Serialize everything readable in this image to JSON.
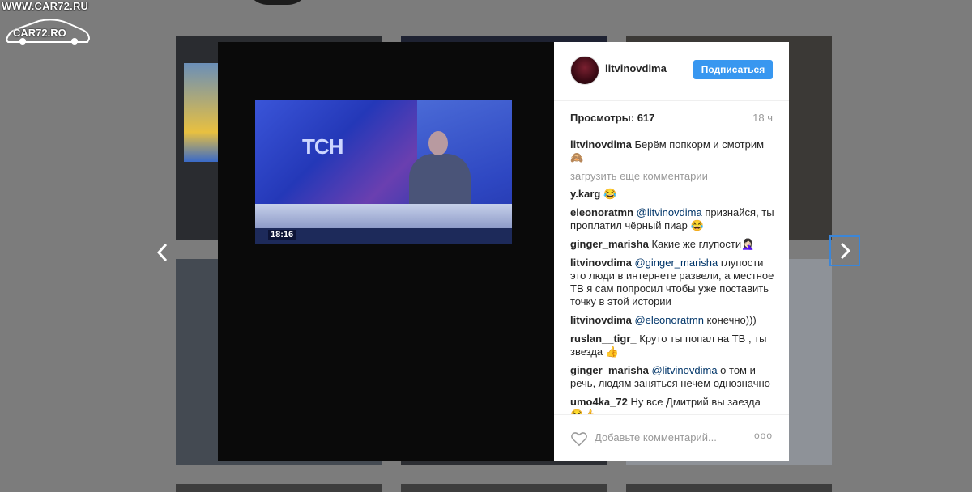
{
  "watermark": {
    "url": "WWW.CAR72.RU",
    "logo_text": "CAR72.RO"
  },
  "video": {
    "time": "18:16",
    "channel": "ТСН"
  },
  "post": {
    "username": "litvinovdima",
    "follow_label": "Подписаться",
    "views_text": "Просмотры: 617",
    "age": "18 ч",
    "load_more": "загрузить еще комментарии",
    "comment_placeholder": "Добавьте комментарий...",
    "more_options": "ooo",
    "caption": {
      "user": "litvinovdima",
      "text": " Берём попкорм и смотрим🙈"
    },
    "comments": [
      {
        "user": "y.karg",
        "mention": "",
        "text": " 😂"
      },
      {
        "user": "eleonoratmn",
        "mention": " @litvinovdima",
        "text": " признайся, ты проплатил чёрный пиар 😂"
      },
      {
        "user": "ginger_marisha",
        "mention": "",
        "text": " Какие же глупости🤦🏻‍♀"
      },
      {
        "user": "litvinovdima",
        "mention": " @ginger_marisha",
        "text": " глупости это люди в интернете развели, а местное ТВ я сам попросил чтобы уже поставить точку в этой истории"
      },
      {
        "user": "litvinovdima",
        "mention": " @eleonoratmn",
        "text": " конечно)))"
      },
      {
        "user": "ruslan__tigr_",
        "mention": "",
        "text": " Круто ты попал на ТВ , ты звезда 👍"
      },
      {
        "user": "ginger_marisha",
        "mention": " @litvinovdima",
        "text": " о том и речь, людям заняться нечем однозначно"
      },
      {
        "user": "umo4ka_72",
        "mention": "",
        "text": " Ну все Дмитрий вы заезда 😂👍"
      }
    ]
  },
  "colors": {
    "accent": "#3897f0",
    "mention": "#003569",
    "next_focus": "#3b86d8"
  }
}
